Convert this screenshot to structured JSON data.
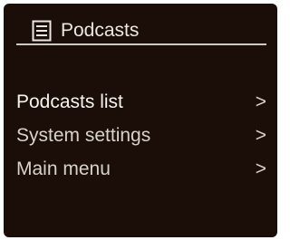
{
  "header": {
    "title": "Podcasts",
    "icon": "list-document-icon"
  },
  "menu": {
    "items": [
      {
        "label": "Podcasts list",
        "arrow": ">",
        "selected": true
      },
      {
        "label": "System settings",
        "arrow": ">",
        "selected": false
      },
      {
        "label": "Main menu",
        "arrow": ">",
        "selected": false
      }
    ]
  },
  "colors": {
    "background": "#1b0e08",
    "text": "#e9e4df"
  }
}
